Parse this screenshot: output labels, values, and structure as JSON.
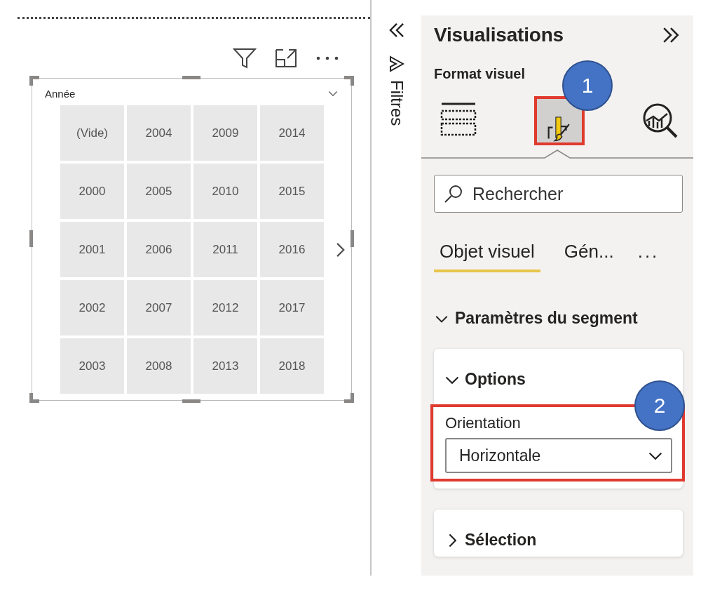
{
  "report_canvas": {
    "visual_header": [
      {
        "kind": "filter"
      },
      {
        "kind": "focus"
      },
      {
        "kind": "more"
      }
    ],
    "slicer": {
      "title": "Année",
      "tiles": [
        "(Vide)",
        "2000",
        "2001",
        "2002",
        "2003",
        "2004",
        "2005",
        "2006",
        "2007",
        "2008",
        "2009",
        "2010",
        "2011",
        "2012",
        "2013",
        "2014",
        "2015",
        "2016",
        "2017",
        "2018"
      ]
    }
  },
  "filters_pane": {
    "title": "Filtres"
  },
  "visualizations_pane": {
    "title": "Visualisations",
    "subtitle": "Format visuel",
    "pane_tabs": [
      {
        "kind": "fields",
        "selected": false,
        "highlighted": false
      },
      {
        "kind": "format",
        "selected": true,
        "highlighted": true
      },
      {
        "kind": "analytics",
        "selected": false,
        "highlighted": false
      }
    ],
    "search": {
      "placeholder": "Rechercher"
    },
    "tabs": [
      {
        "label": "Objet visuel",
        "selected": true
      },
      {
        "label": "Gén...",
        "selected": false
      }
    ],
    "more": "...",
    "section": {
      "title": "Paramètres du segment",
      "expanded": true
    },
    "cards": [
      {
        "title": "Options",
        "expanded": true,
        "field": {
          "label": "Orientation",
          "value": "Horizontale",
          "highlighted": true
        }
      },
      {
        "title": "Sélection",
        "expanded": false
      }
    ],
    "callouts": [
      {
        "label": "1"
      },
      {
        "label": "2"
      }
    ]
  }
}
